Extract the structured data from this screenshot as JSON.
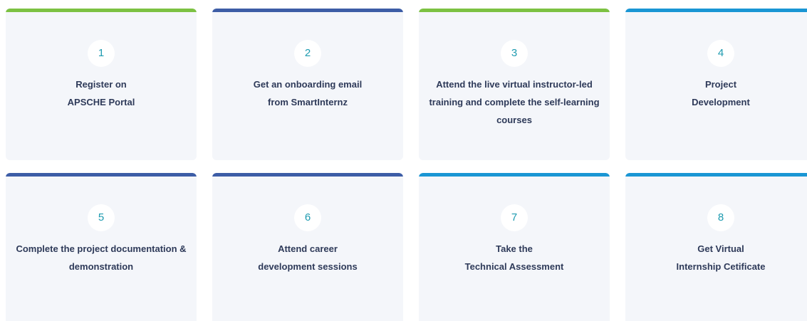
{
  "colors": {
    "green": "#7cc142",
    "navy": "#3d5da6",
    "sky": "#1a96d4",
    "card_bg": "#f4f6fa",
    "number": "#1e9bb0",
    "text": "#2e3a59"
  },
  "steps": [
    {
      "number": "1",
      "lines": [
        "Register on",
        "APSCHE Portal"
      ],
      "accent": "green"
    },
    {
      "number": "2",
      "lines": [
        "Get an onboarding email",
        "from SmartInternz"
      ],
      "accent": "navy"
    },
    {
      "number": "3",
      "lines": [
        "Attend the live virtual instructor-led",
        "training and complete the self-learning",
        "courses"
      ],
      "accent": "green"
    },
    {
      "number": "4",
      "lines": [
        "Project",
        "Development"
      ],
      "accent": "sky"
    },
    {
      "number": "5",
      "lines": [
        "Complete the project documentation &",
        "demonstration"
      ],
      "accent": "navy"
    },
    {
      "number": "6",
      "lines": [
        "Attend career",
        "development sessions"
      ],
      "accent": "navy"
    },
    {
      "number": "7",
      "lines": [
        "Take the",
        "Technical Assessment"
      ],
      "accent": "sky"
    },
    {
      "number": "8",
      "lines": [
        "Get Virtual",
        "Internship Cetificate"
      ],
      "accent": "sky"
    }
  ]
}
